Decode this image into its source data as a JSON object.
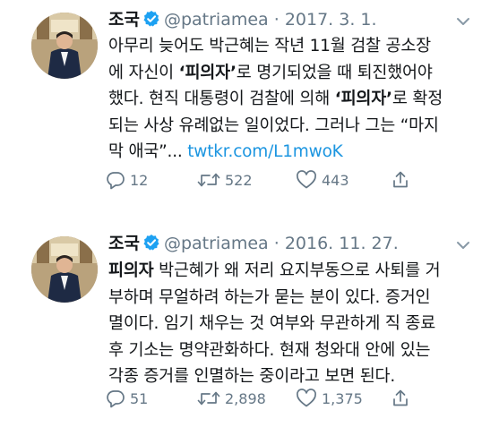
{
  "tweets": [
    {
      "author_name": "조국",
      "handle": "@patriamea",
      "separator": "·",
      "date": "2017. 3. 1.",
      "lines": [
        [
          {
            "t": "아무리 늦어도 박근혜는 작년 11월 검찰 공소장",
            "b": false
          }
        ],
        [
          {
            "t": "에 자신이 ",
            "b": false
          },
          {
            "t": "‘피의자’",
            "b": true
          },
          {
            "t": "로 명기되었을 때 퇴진했어야",
            "b": false
          }
        ],
        [
          {
            "t": "했다. 현직 대통령이 검찰에 의해 ",
            "b": false
          },
          {
            "t": "‘피의자’",
            "b": true
          },
          {
            "t": "로 확정",
            "b": false
          }
        ],
        [
          {
            "t": "되는 사상 유례없는 일이었다. 그러나 그는 “마지",
            "b": false
          }
        ],
        [
          {
            "t": "막 애국”... ",
            "b": false
          },
          {
            "t": "twtkr.com/L1mwoK",
            "b": false,
            "link": true
          }
        ]
      ],
      "replies": "12",
      "retweets": "522",
      "likes": "443"
    },
    {
      "author_name": "조국",
      "handle": "@patriamea",
      "separator": "·",
      "date": "2016. 11. 27.",
      "lines": [
        [
          {
            "t": "피의자",
            "b": true
          },
          {
            "t": " 박근혜가 왜 저리 요지부동으로 사퇴를 거",
            "b": false
          }
        ],
        [
          {
            "t": "부하며 무얼하려 하는가 묻는 분이 있다. 증거인",
            "b": false
          }
        ],
        [
          {
            "t": "멸이다. 임기 채우는 것 여부와 무관하게 직 종료",
            "b": false
          }
        ],
        [
          {
            "t": "후 기소는 명약관화하다. 현재 청와대 안에 있는",
            "b": false
          }
        ],
        [
          {
            "t": "각종 증거를 인멸하는 중이라고 보면 된다.",
            "b": false
          }
        ]
      ],
      "replies": "51",
      "retweets": "2,898",
      "likes": "1,375"
    }
  ],
  "icons": {
    "verified": "verified-badge-icon",
    "menu": "chevron-down-icon",
    "reply": "reply-icon",
    "retweet": "retweet-icon",
    "like": "heart-icon",
    "share": "share-icon"
  },
  "colors": {
    "text": "#14171a",
    "secondary": "#657786",
    "link": "#1b95e0",
    "verified": "#1da1f2"
  }
}
